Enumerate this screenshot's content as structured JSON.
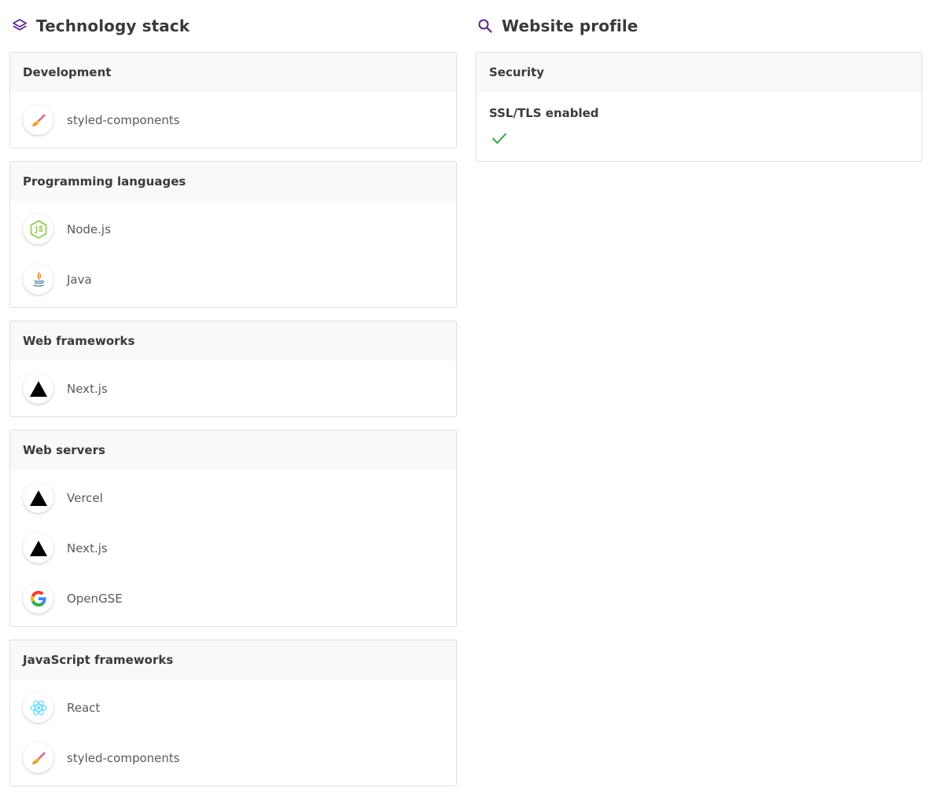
{
  "technology_stack": {
    "title": "Technology stack",
    "title_icon": "layers-icon",
    "categories": [
      {
        "name": "Development",
        "items": [
          {
            "label": "styled-components",
            "icon": "styled-components-icon"
          }
        ]
      },
      {
        "name": "Programming languages",
        "items": [
          {
            "label": "Node.js",
            "icon": "nodejs-icon"
          },
          {
            "label": "Java",
            "icon": "java-icon"
          }
        ]
      },
      {
        "name": "Web frameworks",
        "items": [
          {
            "label": "Next.js",
            "icon": "nextjs-icon"
          }
        ]
      },
      {
        "name": "Web servers",
        "items": [
          {
            "label": "Vercel",
            "icon": "vercel-icon"
          },
          {
            "label": "Next.js",
            "icon": "nextjs-icon"
          },
          {
            "label": "OpenGSE",
            "icon": "google-icon"
          }
        ]
      },
      {
        "name": "JavaScript frameworks",
        "items": [
          {
            "label": "React",
            "icon": "react-icon"
          },
          {
            "label": "styled-components",
            "icon": "styled-components-icon"
          }
        ]
      }
    ]
  },
  "website_profile": {
    "title": "Website profile",
    "title_icon": "search-icon",
    "security": {
      "header": "Security",
      "label": "SSL/TLS enabled",
      "status_icon": "checkmark-icon"
    }
  },
  "colors": {
    "accent": "#5b2a86",
    "check": "#3aa346",
    "card_border": "#dedede",
    "card_header_bg": "#f9f9f9"
  }
}
